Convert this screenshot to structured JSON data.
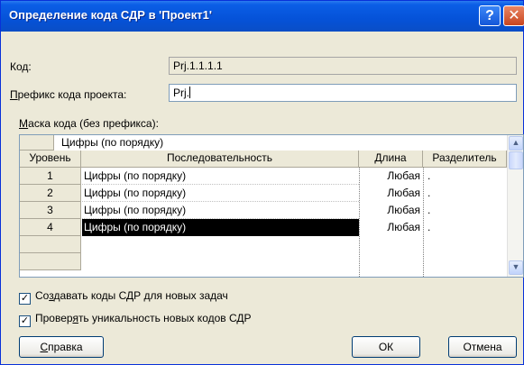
{
  "window": {
    "title": "Определение кода СДР в 'Проект1'",
    "help_glyph": "?",
    "close_glyph": "✕"
  },
  "code": {
    "label": "Код:",
    "value": "Prj.1.1.1.1"
  },
  "prefix": {
    "label_mnemonic": "П",
    "label_rest": "рефикс кода проекта:",
    "value": "Prj."
  },
  "mask": {
    "label_mnemonic": "М",
    "label_rest": "аска кода (без префикса):",
    "combo_value": "Цифры (по порядку)",
    "columns": [
      "Уровень",
      "Последовательность",
      "Длина",
      "Разделитель"
    ],
    "rows": [
      {
        "level": "1",
        "sequence": "Цифры (по порядку)",
        "length": "Любая",
        "separator": "."
      },
      {
        "level": "2",
        "sequence": "Цифры (по порядку)",
        "length": "Любая",
        "separator": "."
      },
      {
        "level": "3",
        "sequence": "Цифры (по порядку)",
        "length": "Любая",
        "separator": "."
      },
      {
        "level": "4",
        "sequence": "Цифры (по порядку)",
        "length": "Любая",
        "separator": "."
      }
    ],
    "selected_row": 3
  },
  "options": {
    "create_codes": {
      "pre": "Со",
      "mnemonic": "з",
      "post": "давать коды СДР для новых задач",
      "checked": true
    },
    "verify_unique": {
      "pre": "Провер",
      "mnemonic": "я",
      "post": "ть уникальность новых кодов СДР",
      "checked": true
    },
    "check_glyph": "✓"
  },
  "buttons": {
    "help_mnemonic": "С",
    "help_rest": "правка",
    "ok": "ОК",
    "cancel": "Отмена"
  },
  "icons": {
    "scroll_up": "▲",
    "scroll_down": "▼"
  }
}
